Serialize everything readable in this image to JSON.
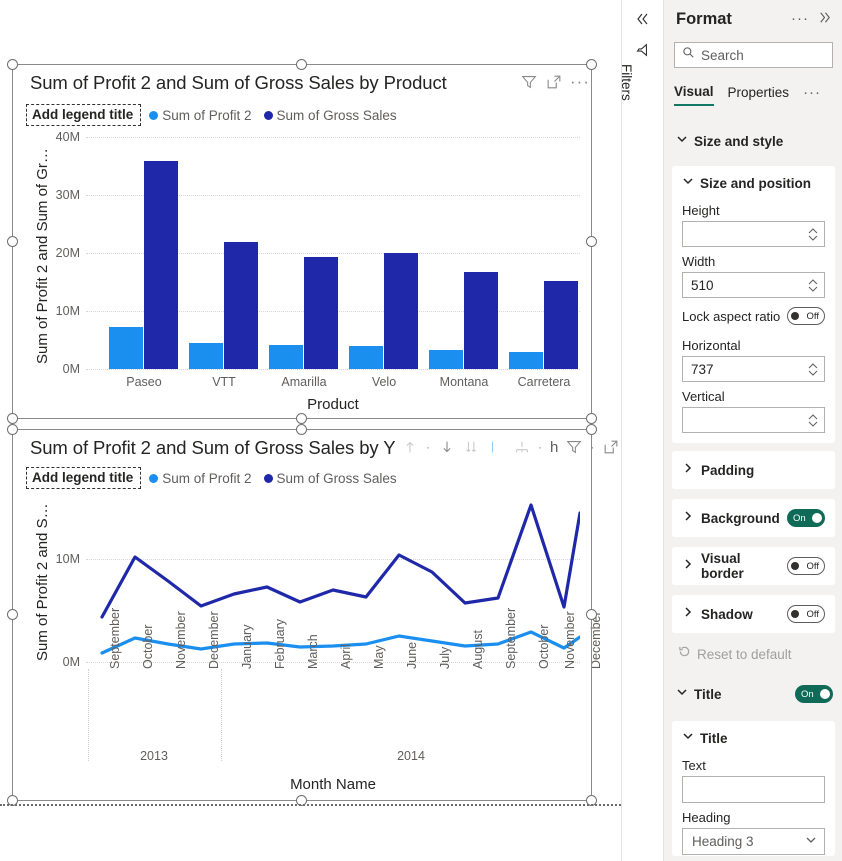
{
  "app": {
    "rail": {
      "collapse_icon": "double-chevron-left-icon",
      "filter_icon": "filter-icon",
      "filters_label": "Filters"
    },
    "format_pane": {
      "title": "Format",
      "more_options": "···",
      "expand_icon": "double-chevron-right-icon",
      "search": {
        "placeholder": "Search",
        "value": "",
        "icon": "search-icon"
      },
      "tabs": [
        {
          "label": "Visual",
          "active": true
        },
        {
          "label": "Properties",
          "active": false
        }
      ],
      "tabs_more": "···",
      "sections": {
        "size_and_style": {
          "label": "Size and style",
          "expanded": true,
          "size_and_position": {
            "label": "Size and position",
            "expanded": true,
            "height": {
              "label": "Height",
              "value": ""
            },
            "width": {
              "label": "Width",
              "value": "510"
            },
            "lock_aspect_ratio": {
              "label": "Lock aspect ratio",
              "state": "Off"
            },
            "horizontal": {
              "label": "Horizontal",
              "value": "737"
            },
            "vertical": {
              "label": "Vertical",
              "value": ""
            }
          },
          "padding": {
            "label": "Padding",
            "expanded": false
          },
          "background": {
            "label": "Background",
            "expanded": false,
            "state": "On"
          },
          "visual_border": {
            "label": "Visual border",
            "expanded": false,
            "state": "Off"
          },
          "shadow": {
            "label": "Shadow",
            "expanded": false,
            "state": "Off"
          },
          "reset": {
            "label": "Reset to default",
            "icon": "reset-icon"
          }
        },
        "title": {
          "label": "Title",
          "state": "On",
          "expanded": true,
          "card": {
            "label": "Title",
            "text": {
              "label": "Text",
              "value": ""
            },
            "heading": {
              "label": "Heading",
              "value": "Heading 3"
            }
          }
        }
      }
    }
  },
  "colors": {
    "series_profit": "#1A8FF0",
    "series_gross_sales": "#1F28A8",
    "accent_teal": "#117865",
    "toggle_on": "#0f6b58",
    "gridline": "#d6d6d6",
    "text_primary": "#252423",
    "text_secondary": "#605e5c",
    "pane_background": "#f3f2f1"
  },
  "visuals": [
    {
      "id": "bar-chart",
      "title": "Sum of Profit 2 and Sum of Gross Sales by Product",
      "selected": true,
      "toolbar": [
        "filter-icon",
        "focus-mode-icon",
        "more-options-icon"
      ],
      "legend": {
        "title_placeholder": "Add legend title",
        "items": [
          {
            "label": "Sum of Profit 2",
            "color": "#1A8FF0"
          },
          {
            "label": "Sum of Gross Sales",
            "color": "#1F28A8"
          }
        ]
      },
      "chart_data": {
        "type": "bar",
        "title": "Sum of Profit 2 and Sum of Gross Sales by Product",
        "xlabel": "Product",
        "ylabel": "Sum of Profit 2 and Sum of Gr…",
        "ylabel_full": "Sum of Profit 2 and Sum of Gross Sales",
        "categories": [
          "Paseo",
          "VTT",
          "Amarilla",
          "Velo",
          "Montana",
          "Carretera"
        ],
        "yticks": [
          "0M",
          "10M",
          "20M",
          "30M",
          "40M"
        ],
        "ylim": [
          0,
          40000000
        ],
        "grid": true,
        "legend_position": "top",
        "series": [
          {
            "name": "Sum of Profit 2",
            "color": "#1A8FF0",
            "values": [
              7200000,
              4500000,
              4100000,
              3900000,
              3200000,
              2900000
            ]
          },
          {
            "name": "Sum of Gross Sales",
            "color": "#1F28A8",
            "values": [
              35800000,
              21800000,
              19300000,
              20000000,
              16700000,
              15100000
            ]
          }
        ]
      }
    },
    {
      "id": "line-chart",
      "title": "Sum of Profit 2 and Sum of Gross Sales by Y",
      "title_truncated": true,
      "selected": true,
      "toolbar": [
        "sort-ascending-icon",
        "sort-descending-icon",
        "drill-down-icon",
        "drill-up-icon",
        "expand-hierarchy-icon",
        "filter-icon",
        "focus-mode-icon",
        "more-options-icon"
      ],
      "legend": {
        "title_placeholder": "Add legend title",
        "items": [
          {
            "label": "Sum of Profit 2",
            "color": "#1A8FF0"
          },
          {
            "label": "Sum of Gross Sales",
            "color": "#1F28A8"
          }
        ]
      },
      "chart_data": {
        "type": "line",
        "title": "Sum of Profit 2 and Sum of Gross Sales by Y",
        "xlabel": "Month Name",
        "ylabel": "Sum of Profit 2 and S…",
        "ylabel_full": "Sum of Profit 2 and Sum of Gross Sales",
        "yticks": [
          "0M",
          "10M"
        ],
        "ylim": [
          0,
          16000000
        ],
        "grid": true,
        "legend_position": "top",
        "categories": [
          "September",
          "October",
          "November",
          "December",
          "January",
          "February",
          "March",
          "April",
          "May",
          "June",
          "July",
          "August",
          "September",
          "October",
          "November",
          "December"
        ],
        "year_groups": [
          {
            "label": "2013",
            "months": 4
          },
          {
            "label": "2014",
            "months": 12
          }
        ],
        "series": [
          {
            "name": "Sum of Profit 2",
            "color": "#1A8FF0",
            "values": [
              900000,
              2300000,
              1700000,
              1300000,
              1700000,
              1800000,
              1500000,
              1600000,
              1700000,
              2500000,
              2000000,
              1600000,
              1700000,
              2900000,
              1400000,
              2400000
            ]
          },
          {
            "name": "Sum of Gross Sales",
            "color": "#1F28A8",
            "values": [
              4400000,
              10200000,
              7900000,
              5400000,
              6600000,
              7300000,
              5800000,
              7000000,
              6300000,
              10400000,
              8700000,
              5700000,
              6200000,
              15300000,
              5300000,
              14100000
            ]
          }
        ]
      }
    }
  ]
}
